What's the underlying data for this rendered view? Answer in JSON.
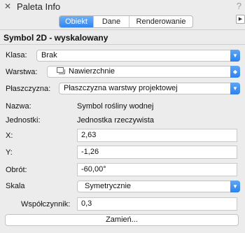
{
  "window": {
    "title": "Paleta Info",
    "close_glyph": "✕",
    "help_glyph": "?"
  },
  "tabs": [
    {
      "label": "Obiekt",
      "active": true
    },
    {
      "label": "Dane",
      "active": false
    },
    {
      "label": "Renderowanie",
      "active": false
    }
  ],
  "object_header": "Symbol 2D - wyskalowany",
  "fields": {
    "klasa": {
      "label": "Klasa:",
      "value": "Brak"
    },
    "warstwa": {
      "label": "Warstwa:",
      "value": "Nawierzchnie"
    },
    "plaszczyzna": {
      "label": "Płaszczyzna:",
      "value": "Płaszczyzna warstwy projektowej"
    },
    "nazwa": {
      "label": "Nazwa:",
      "value": "Symbol rośliny wodnej"
    },
    "jednostki": {
      "label": "Jednostki:",
      "value": "Jednostka rzeczywista"
    },
    "x": {
      "label": "X:",
      "value": "2,63"
    },
    "y": {
      "label": "Y:",
      "value": "-1,26"
    },
    "obrot": {
      "label": "Obrót:",
      "value": "-60,00°"
    },
    "skala": {
      "label": "Skala",
      "value": "Symetrycznie"
    },
    "wspolczynnik": {
      "label": "Współczynnik:",
      "value": "0,3"
    }
  },
  "buttons": {
    "zamien": "Zamień..."
  },
  "icons": {
    "close": "close-icon",
    "help": "help-icon",
    "panel_menu": "triangle-right-icon",
    "popup_arrow": "chevron-down-icon",
    "stepper_arrow": "up-down-chevron-icon",
    "layer": "layer-icon"
  },
  "colors": {
    "accent": "#2f86f0",
    "background": "#ececec"
  }
}
